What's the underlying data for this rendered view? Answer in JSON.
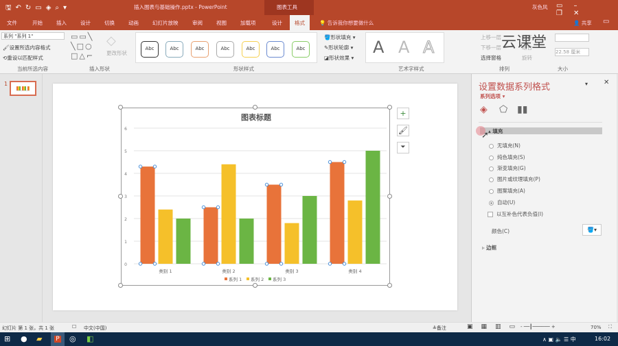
{
  "titlebar": {
    "doc_title": "插入图表与基础操作.pptx - PowerPoint",
    "context_tool": "图表工具",
    "user": "灰色风",
    "qat": [
      "save-icon",
      "undo-icon",
      "redo-icon",
      "presenter-icon",
      "paint-icon",
      "preview-icon"
    ]
  },
  "tabs": [
    "文件",
    "开始",
    "插入",
    "设计",
    "切换",
    "动画",
    "幻灯片放映",
    "审阅",
    "视图",
    "加载项",
    "设计",
    "格式"
  ],
  "active_tab": "格式",
  "tellme": "告诉我你想要做什么",
  "share": "共享",
  "ribbon": {
    "current_selection": {
      "dropdown": "系列 \"系列 1\"",
      "format_selection": "设置所选内容格式",
      "reset_match": "重设以匹配样式",
      "label": "当前所选内容"
    },
    "insert_shapes": {
      "change_shape": "更改形状",
      "label": "插入形状"
    },
    "shape_styles": {
      "swatch_text": "Abc",
      "fill": "形状填充",
      "outline": "形状轮廓",
      "effects": "形状效果",
      "label": "形状样式"
    },
    "wordart": {
      "letter": "A",
      "label": "艺术字样式"
    },
    "arrange": {
      "bring_forward": "上移一层",
      "send_backward": "下移一层",
      "selection_pane": "选择窗格",
      "align": "对齐",
      "group": "组合",
      "rotate": "旋转",
      "label": "排列"
    },
    "size": {
      "height": "",
      "width": "22.58 厘米",
      "label": "大小"
    }
  },
  "watermark": "云课堂",
  "slide_number": "1",
  "chart_data": {
    "type": "bar",
    "title": "图表标题",
    "categories": [
      "类别 1",
      "类别 2",
      "类别 3",
      "类别 4"
    ],
    "series": [
      {
        "name": "系列 1",
        "color": "#e8733a",
        "values": [
          4.3,
          2.5,
          3.5,
          4.5
        ]
      },
      {
        "name": "系列 2",
        "color": "#f5c02a",
        "values": [
          2.4,
          4.4,
          1.8,
          2.8
        ]
      },
      {
        "name": "系列 3",
        "color": "#6bb544",
        "values": [
          2,
          2,
          3,
          5
        ]
      }
    ],
    "yticks": [
      "0",
      "1",
      "2",
      "3",
      "4",
      "5",
      "6"
    ],
    "ylim": [
      0,
      6
    ],
    "grid": true,
    "legend": "bottom"
  },
  "pane": {
    "title": "设置数据系列格式",
    "subtitle": "系列选项",
    "fill_section": "填充",
    "options": [
      "无填充(N)",
      "纯色填充(S)",
      "渐变填充(G)",
      "图片或纹理填充(P)",
      "图案填充(A)",
      "自动(U)"
    ],
    "selected_option": "自动(U)",
    "invert": "以互补色代表负值(I)",
    "color_label": "颜色(C)",
    "border_section": "边框"
  },
  "status": {
    "slide_info": "幻灯片 第 1 张，共 1 张",
    "language": "中文(中国)",
    "notes": "备注",
    "zoom": "70%"
  },
  "taskbar": {
    "time": "16:02",
    "ime": "中"
  }
}
